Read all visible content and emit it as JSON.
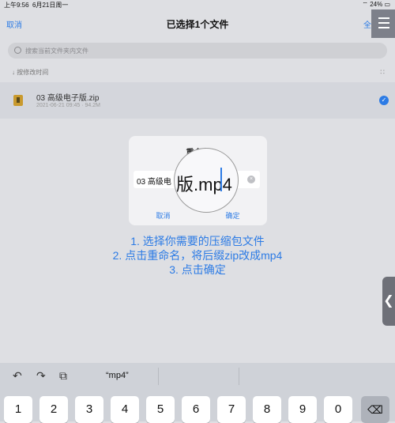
{
  "status": {
    "time": "上午9:56",
    "date": "6月21日周一",
    "battery": "24%"
  },
  "navbar": {
    "cancel": "取消",
    "title": "已选择1个文件",
    "select_all": "全"
  },
  "search": {
    "placeholder": "搜索当前文件夹内文件"
  },
  "sort": {
    "label": "↓ 按修改时间",
    "grid": "∷"
  },
  "file": {
    "name": "03 高级电子版.zip",
    "meta": "2021-06-21 09:45 · 94.2M",
    "check": "✓"
  },
  "dialog": {
    "title": "重命名",
    "value": "03 高级电",
    "clear": "×",
    "cancel": "取消",
    "ok": "确定"
  },
  "magnifier": {
    "text": "版.mp4"
  },
  "instructions": {
    "line1": "1. 选择你需要的压缩包文件",
    "line2": "2. 点击重命名，将后缀zip改成mp4",
    "line3": "3. 点击确定"
  },
  "sidehandle": {
    "glyph": "❮"
  },
  "keyboard": {
    "undo": "↶",
    "redo": "↷",
    "paste": "⧉",
    "suggestion": "“mp4”",
    "keys": [
      "1",
      "2",
      "3",
      "4",
      "5",
      "6",
      "7",
      "8",
      "9",
      "0"
    ],
    "backspace": "⌫"
  }
}
